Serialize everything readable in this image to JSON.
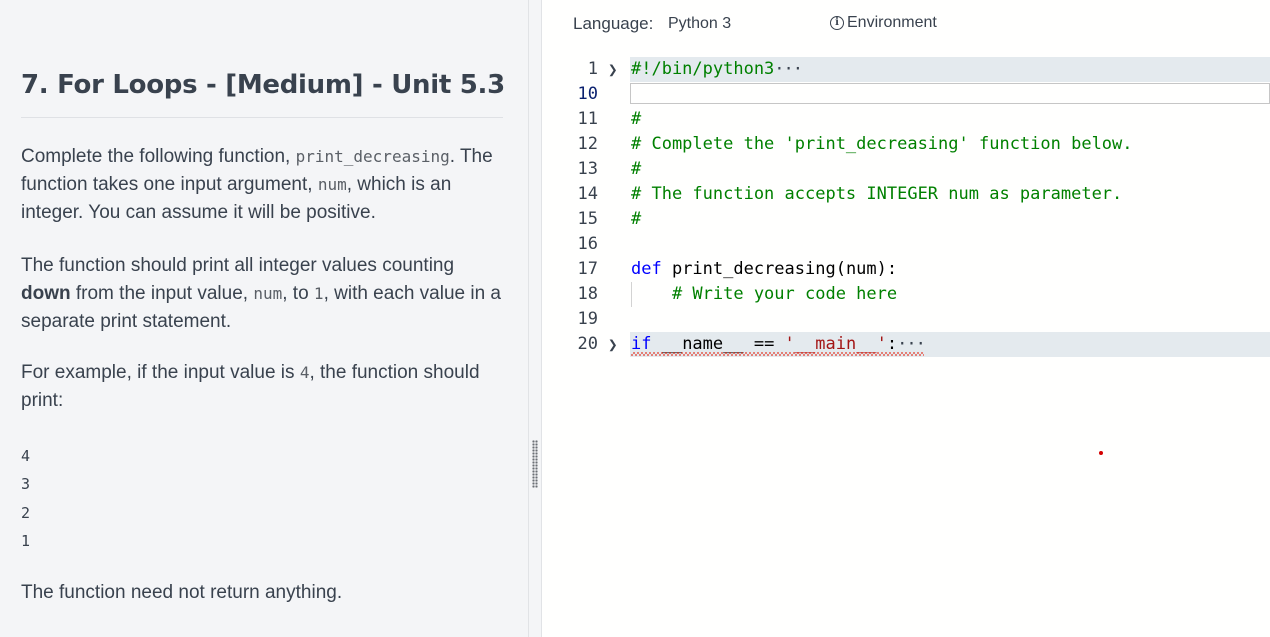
{
  "problem": {
    "title": "7. For Loops - [Medium] - Unit 5.3",
    "p1": {
      "t1": "Complete the following function, ",
      "c1": "print_decreasing",
      "t2": ". The function takes one input argument, ",
      "c2": "num",
      "t3": ", which is an integer. You can assume it will be positive."
    },
    "p2": {
      "t1": "The function should print all integer values counting ",
      "b1": "down",
      "t2": " from the input value, ",
      "c1": "num",
      "t3": ", to ",
      "c2": "1",
      "t4": ", with each value in a separate print statement."
    },
    "p3": {
      "t1": "For example, if the input value is ",
      "c1": "4",
      "t2": ", the function should print:"
    },
    "example_output": [
      "4",
      "3",
      "2",
      "1"
    ],
    "p4": "The function need not return anything."
  },
  "editor": {
    "language_label": "Language:",
    "language_value": "Python 3",
    "environment_label": "Environment",
    "fold_icon": "chevron-right-icon",
    "lines": [
      {
        "num": "1",
        "code": "#!/bin/python3",
        "ellipsis": "···"
      },
      {
        "num": "10",
        "code": ""
      },
      {
        "num": "11",
        "code": "#"
      },
      {
        "num": "12",
        "code": "# Complete the 'print_decreasing' function below."
      },
      {
        "num": "13",
        "code": "#"
      },
      {
        "num": "14",
        "code": "# The function accepts INTEGER num as parameter."
      },
      {
        "num": "15",
        "code": "#"
      },
      {
        "num": "16",
        "code": ""
      },
      {
        "num": "17",
        "code_kw": "def",
        "code_rest": " print_decreasing(num):"
      },
      {
        "num": "18",
        "code": "    # Write your code here"
      },
      {
        "num": "19",
        "code": ""
      },
      {
        "num": "20",
        "code_kw": "if",
        "code_mid": " __name__ == ",
        "code_str": "'__main__'",
        "code_end": ":",
        "ellipsis": "···"
      }
    ]
  },
  "colors": {
    "comment": "#008000",
    "keyword": "#0000ff",
    "string": "#a31515",
    "error_squiggle": "#e51400",
    "panel_bg": "#f4f5f7",
    "text": "#39424e"
  }
}
